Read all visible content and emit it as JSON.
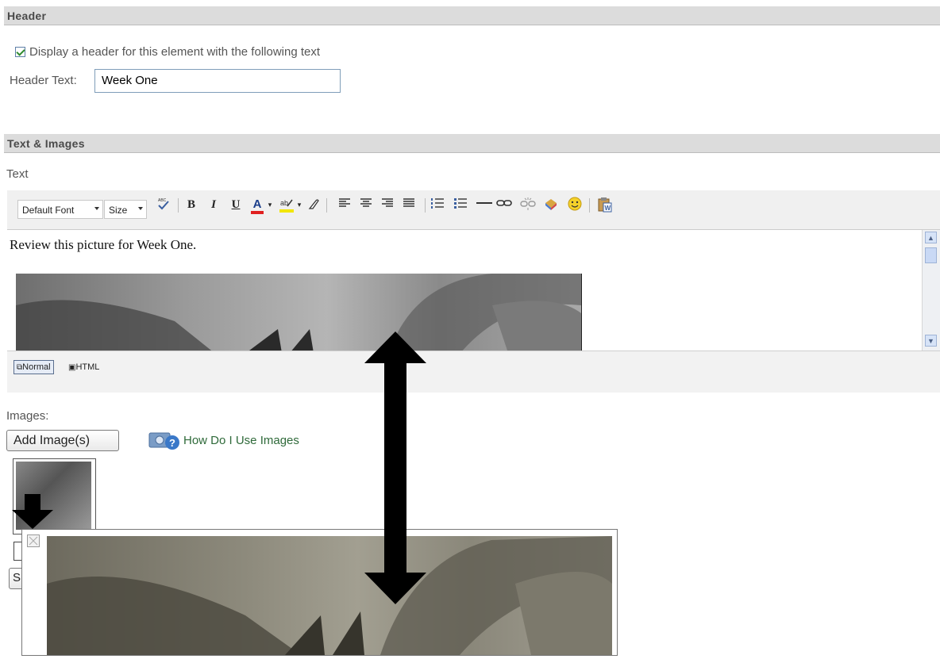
{
  "header_section": {
    "title": "Header",
    "checkbox_label": "Display a header for this element with the following text",
    "checkbox_checked": true,
    "header_text_label": "Header Text:",
    "header_text_value": "Week One"
  },
  "text_images_section": {
    "title": "Text & Images",
    "text_label": "Text",
    "toolbar": {
      "font_select": "Default Font",
      "size_select": "Size",
      "bold": "B",
      "italic": "I",
      "underline": "U",
      "font_color": "A"
    },
    "editor_content": "Review this picture for Week One.",
    "mode_normal": "Normal",
    "mode_html": "HTML",
    "images_label": "Images:",
    "add_images_button": "Add Image(s)",
    "help_link": "How Do I Use Images",
    "partial_button_text": "S"
  }
}
